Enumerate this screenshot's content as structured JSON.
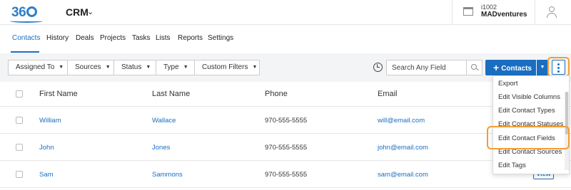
{
  "header": {
    "logo_text": "360",
    "app_name": "CRM",
    "account_id": "i1002",
    "account_name": "MADventures"
  },
  "nav": {
    "tabs": [
      {
        "label": "Contacts",
        "active": true
      },
      {
        "label": "History"
      },
      {
        "label": "Deals"
      },
      {
        "label": "Projects"
      },
      {
        "label": "Tasks"
      },
      {
        "label": "Lists"
      },
      {
        "label": "Reports"
      },
      {
        "label": "Settings"
      }
    ]
  },
  "filters": {
    "assigned_to": "Assigned To",
    "sources": "Sources",
    "status": "Status",
    "type": "Type",
    "custom_filters": "Custom Filters",
    "search_placeholder": "Search Any Field",
    "add_contacts_label": "Contacts"
  },
  "table": {
    "columns": [
      "First Name",
      "Last Name",
      "Phone",
      "Email"
    ],
    "rows": [
      {
        "first": "William",
        "last": "Wallace",
        "phone": "970-555-5555",
        "email": "will@email.com"
      },
      {
        "first": "John",
        "last": "Jones",
        "phone": "970-555-5555",
        "email": "john@email.com"
      },
      {
        "first": "Sam",
        "last": "Sammons",
        "phone": "970-555-5555",
        "email": "sam@email.com",
        "action": "View"
      }
    ]
  },
  "menu": {
    "items": [
      "Export",
      "Edit Visible Columns",
      "Edit Contact Types",
      "Edit Contact Statuses",
      "Edit Contact Fields",
      "Edit Contact Sources",
      "Edit Tags"
    ],
    "highlighted": "Edit Contact Fields"
  },
  "colors": {
    "accent": "#1a6ec1",
    "highlight": "#f39c34",
    "filter_bar": "#f2f4f6"
  },
  "icons": [
    "logo",
    "chevron-down-icon",
    "store-icon",
    "user-icon",
    "history-icon",
    "search-icon",
    "plus-icon",
    "caret-down-icon",
    "kebab-icon"
  ]
}
